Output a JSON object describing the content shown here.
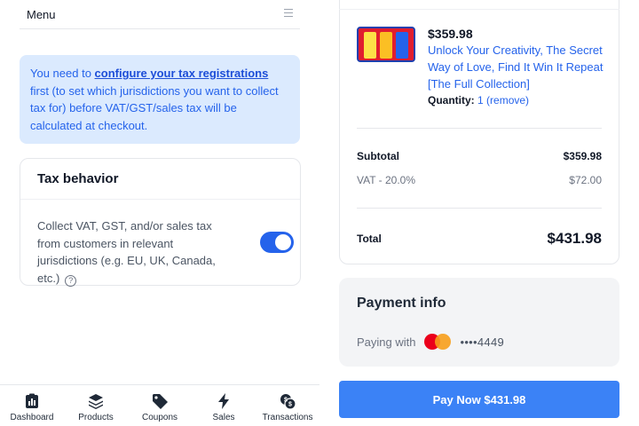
{
  "menu": {
    "label": "Menu",
    "icon": "hamburger-icon"
  },
  "notice": {
    "prefix": "You need to ",
    "link": "configure your tax registrations",
    "suffix": " first (to set which jurisdictions you want to collect tax for) before VAT/GST/sales tax will be calculated at checkout."
  },
  "tax_behavior": {
    "title": "Tax behavior",
    "description": "Collect VAT, GST, and/or sales tax from customers in relevant jurisdictions (e.g. EU, UK, Canada, etc.)",
    "help_glyph": "?",
    "enabled": true
  },
  "bottom_nav": [
    {
      "label": "Dashboard",
      "icon": "dashboard-icon"
    },
    {
      "label": "Products",
      "icon": "layers-icon"
    },
    {
      "label": "Coupons",
      "icon": "tag-icon"
    },
    {
      "label": "Sales",
      "icon": "lightning-icon"
    },
    {
      "label": "Transactions",
      "icon": "coins-icon"
    }
  ],
  "order": {
    "price": "$359.98",
    "title": "Unlock Your Creativity, The Secret Way of Love, Find It Win It Repeat [The Full Collection]",
    "quantity_label": "Quantity:",
    "quantity_value": "1",
    "remove_label": "(remove)",
    "subtotal_label": "Subtotal",
    "subtotal_value": "$359.98",
    "vat_label": "VAT - 20.0%",
    "vat_value": "$72.00",
    "total_label": "Total",
    "total_value": "$431.98"
  },
  "payment": {
    "title": "Payment info",
    "paying_with": "Paying with",
    "card_brand_icon": "mastercard-icon",
    "card_number": "••••4449",
    "brand_colors": [
      "#eb001b",
      "#f79e1b"
    ]
  },
  "pay_button": {
    "label": "Pay Now $431.98",
    "color": "#3b82f6"
  }
}
